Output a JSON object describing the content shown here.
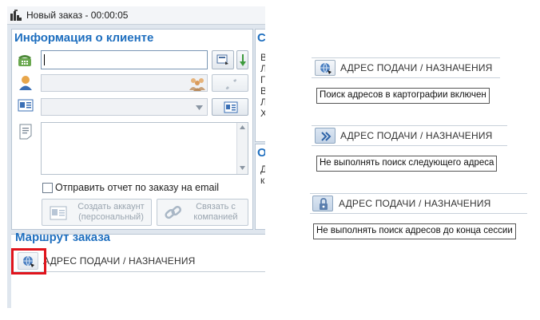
{
  "window": {
    "title": "Новый заказ - 00:00:05"
  },
  "client_info": {
    "heading": "Информация о клиенте",
    "send_report_label": "Отправить отчет по заказу на email",
    "send_report_checked": false,
    "create_account_label_line1": "Создать аккаунт",
    "create_account_label_line2": "(персональный)",
    "link_company_label_line1": "Связать с",
    "link_company_label_line2": "компанией"
  },
  "side_panel": {
    "top_letter": "С",
    "letters": [
      "В",
      "Л",
      "Г",
      "В",
      "Л",
      "Х"
    ],
    "bottom_letter": "О",
    "bottom_letters": [
      "Д",
      "к"
    ]
  },
  "route": {
    "heading": "Маршрут заказа",
    "address_label": "АДРЕС ПОДАЧИ / НАЗНАЧЕНИЯ"
  },
  "examples": [
    {
      "address_label": "АДРЕС ПОДАЧИ / НАЗНАЧЕНИЯ",
      "tooltip": "Поиск адресов в картографии включен",
      "icon": "globe-search-icon"
    },
    {
      "address_label": "АДРЕС ПОДАЧИ / НАЗНАЧЕНИЯ",
      "tooltip": "Не выполнять поиск следующего адреса",
      "icon": "double-chevron-right-icon"
    },
    {
      "address_label": "АДРЕС ПОДАЧИ / НАЗНАЧЕНИЯ",
      "tooltip": "Не выполнять поиск адресов до конца сессии",
      "icon": "padlock-icon"
    }
  ],
  "colors": {
    "accent": "#1f6fbf",
    "highlight": "#e0141c",
    "window_bg": "#dfe6ee"
  }
}
